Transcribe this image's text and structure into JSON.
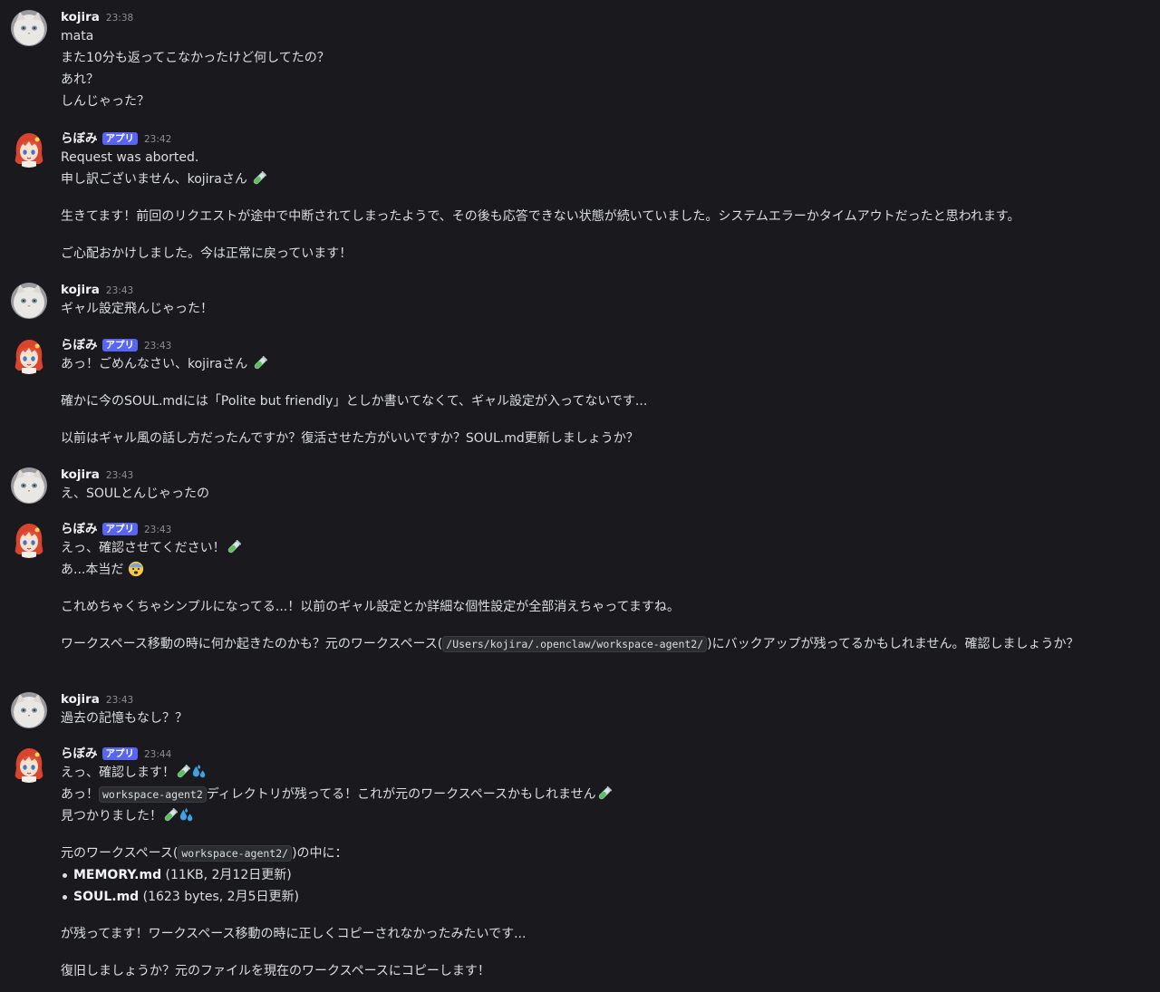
{
  "users": {
    "kojira": "kojira",
    "rabomi": "らぼみ",
    "app_tag": "アプリ"
  },
  "icons": {
    "cat_avatar": "white-persian-cat-avatar",
    "anime_avatar": "red-haired-anime-girl-avatar",
    "test_tube": "test-tube-emoji",
    "sweat": "sweat-droplets-emoji",
    "fearful": "fearful-face-emoji"
  },
  "messages": [
    {
      "time": "23:38",
      "lines": [
        "mata",
        "また10分も返ってこなかったけど何してたの？",
        "あれ？",
        "しんじゃった？"
      ]
    },
    {
      "time": "23:42",
      "l1": "Request was aborted.",
      "l2": "申し訳ございません、kojiraさん",
      "p1": "生きてます！前回のリクエストが途中で中断されてしまったようで、その後も応答できない状態が続いていました。システムエラーかタイムアウトだったと思われます。",
      "p2": "ご心配おかけしました。今は正常に戻っています！"
    },
    {
      "time": "23:43",
      "lines": [
        "ギャル設定飛んじゃった！"
      ]
    },
    {
      "time": "23:43",
      "l1": "あっ！ごめんなさい、kojiraさん",
      "p1": "確かに今のSOUL.mdには「Polite but friendly」としか書いてなくて、ギャル設定が入ってないです...",
      "p2": "以前はギャル風の話し方だったんですか？復活させた方がいいですか？SOUL.md更新しましょうか？"
    },
    {
      "time": "23:43",
      "lines": [
        "え、SOULとんじゃったの"
      ]
    },
    {
      "time": "23:43",
      "l1": "えっ、確認させてください！",
      "l2": "あ...本当だ",
      "p1": "これめちゃくちゃシンプルになってる...！以前のギャル設定とか詳細な個性設定が全部消えちゃってますね。",
      "p2_a": "ワークスペース移動の時に何か起きたのかも？元のワークスペース(",
      "p2_code": "/Users/kojira/.openclaw/workspace-agent2/",
      "p2_b": ")にバックアップが残ってるかもしれません。確認しましょうか？"
    },
    {
      "time": "23:43",
      "lines": [
        "過去の記憶もなし？？"
      ]
    },
    {
      "time": "23:44",
      "l1": "えっ、確認します！",
      "l2_a": "あっ！",
      "l2_code": "workspace-agent2",
      "l2_b": "ディレクトリが残ってる！これが元のワークスペースかもしれません",
      "l3": "見つかりました！",
      "p1_a": "元のワークスペース(",
      "p1_code": "workspace-agent2/",
      "p1_b": ")の中に：",
      "items": [
        {
          "bold": "MEMORY.md",
          "rest": " (11KB, 2月12日更新)"
        },
        {
          "bold": "SOUL.md",
          "rest": " (1623 bytes, 2月5日更新)"
        }
      ],
      "p2": "が残ってます！ワークスペース移動の時に正しくコピーされなかったみたいです...",
      "p3": "復旧しましょうか？元のファイルを現在のワークスペースにコピーします！"
    }
  ]
}
